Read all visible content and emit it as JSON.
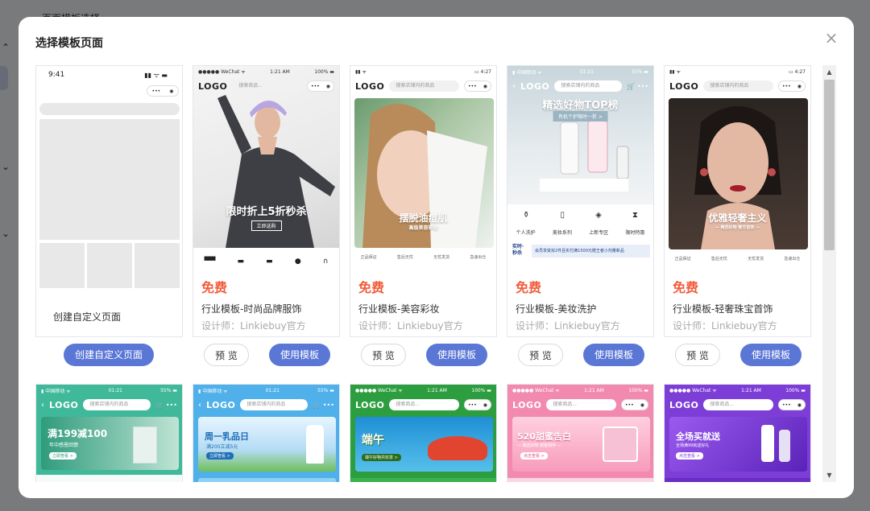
{
  "background": {
    "page_header": "页面模板选择"
  },
  "modal": {
    "title": "选择模板页面",
    "close_label": "×"
  },
  "row1": [
    {
      "kind": "custom",
      "time": "9:41",
      "card_label": "创建自定义页面",
      "button": "创建自定义页面"
    },
    {
      "kind": "template",
      "status_left": "●●●●● WeChat ᯤ",
      "status_mid": "1:21 AM",
      "status_right": "100% ▬",
      "logo": "LOGO",
      "search": "搜索商品...",
      "banner": "限时折上5折秒杀",
      "banner_btn": "立即选购",
      "price": "免费",
      "name": "行业模板-时尚品牌服饰",
      "designer": "设计师：Linkiebuy官方",
      "preview": "预 览",
      "use": "使用模板"
    },
    {
      "kind": "template",
      "status_left": "▮▮ ᯤ",
      "status_mid": "",
      "status_right": "▭ 4:27",
      "logo": "LOGO",
      "search": "搜索店铺内的商品",
      "banner": "摆脱油痘肌",
      "banner_sub": "高级美容彩妆",
      "features": [
        "正品保证",
        "售后无忧",
        "无忧发货",
        "急速出仓"
      ],
      "price": "免费",
      "name": "行业模板-美容彩妆",
      "designer": "设计师：Linkiebuy官方",
      "preview": "预 览",
      "use": "使用模板"
    },
    {
      "kind": "template",
      "status_left": "▮ 中国移动 ᯤ",
      "status_mid": "01:21",
      "status_right": "55% ▬",
      "logo": "LOGO",
      "search": "搜索店铺内的商品",
      "banner": "精选好物TOP榜",
      "banner_btn": "有机个护限时一折 >",
      "categories": [
        "个人洗护",
        "美妆系列",
        "上新专区",
        "限时特惠"
      ],
      "promo_tag": "实时·秒杀",
      "promo_text": "会员享受双2件且实付满1500元赠王者小剂量新品",
      "price": "免费",
      "name": "行业模板-美妆洗护",
      "designer": "设计师：Linkiebuy官方",
      "preview": "预 览",
      "use": "使用模板"
    },
    {
      "kind": "template",
      "status_left": "▮▮ ᯤ",
      "status_mid": "",
      "status_right": "▭ 4:27",
      "logo": "LOGO",
      "search": "搜索店铺内的商品",
      "banner": "优雅轻奢主义",
      "banner_sub": "— 精选好物 奢华首饰 —",
      "features": [
        "正品保证",
        "售后无忧",
        "无忧发货",
        "急速出仓"
      ],
      "price": "免费",
      "name": "行业模板-轻奢珠宝首饰",
      "designer": "设计师：Linkiebuy官方",
      "preview": "预 览",
      "use": "使用模板"
    }
  ],
  "row2": [
    {
      "status_left": "▮ 中国移动 ᯤ",
      "status_mid": "01:21",
      "status_right": "55% ▬",
      "logo": "LOGO",
      "search": "搜索店铺内的商品",
      "banner": "满199减100",
      "banner_sub": "年中感恩回馈",
      "banner_btn": "立即查看 >"
    },
    {
      "status_left": "▮ 中国移动 ᯤ",
      "status_mid": "01:21",
      "status_right": "55% ▬",
      "logo": "LOGO",
      "search": "搜索店铺内的商品",
      "banner": "周一乳品日",
      "banner_sub": "满200立减5元",
      "banner_btn": "立即查看 >"
    },
    {
      "status_left": "●●●●● WeChat ᯤ",
      "status_mid": "1:21 AM",
      "status_right": "100% ▬",
      "logo": "LOGO",
      "search": "搜索商品...",
      "banner": "端午",
      "banner_btn": "端午好物共欢享 >"
    },
    {
      "status_left": "●●●●● WeChat ᯤ",
      "status_mid": "1:21 AM",
      "status_right": "100% ▬",
      "logo": "LOGO",
      "search": "搜索商品...",
      "banner": "520甜蜜告白",
      "banner_sub": "— 臻选好物 甜蜜相伴 —",
      "banner_btn": "点击查看 >"
    },
    {
      "status_left": "●●●●● WeChat ᯤ",
      "status_mid": "1:21 AM",
      "status_right": "100% ▬",
      "logo": "LOGO",
      "search": "搜索商品...",
      "banner": "全场买就送",
      "banner_sub": "全场满99就送好礼",
      "banner_btn": "点击查看 >"
    }
  ]
}
